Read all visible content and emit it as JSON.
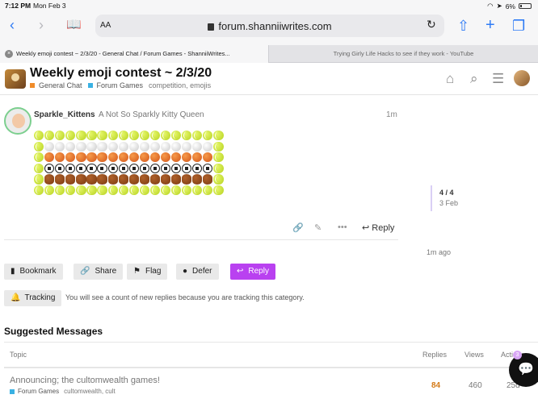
{
  "status": {
    "time": "7:12 PM",
    "date": "Mon Feb 3",
    "battery": "6%"
  },
  "browser": {
    "text_size_label": "AA",
    "url": "forum.shanniiwrites.com",
    "tabs": [
      {
        "title": "Weekly emoji contest ~ 2/3/20 - General Chat / Forum Games - ShanniiWrites...",
        "active": true
      },
      {
        "title": "Trying Girly Life Hacks to see if they work - YouTube",
        "active": false
      }
    ]
  },
  "forum": {
    "topic_title": "Weekly emoji contest ~ 2/3/20",
    "categories": [
      {
        "name": "General Chat",
        "color": "#f08c2a"
      },
      {
        "name": "Forum Games",
        "color": "#3ab1e3"
      }
    ],
    "tags": "competition, emojis"
  },
  "post": {
    "username": "Sparkle_Kittens",
    "user_title": "A Not So Sparkly Kitty Queen",
    "time": "1m",
    "emoji_rows": [
      [
        "tennis",
        "tennis",
        "tennis",
        "tennis",
        "tennis",
        "tennis",
        "tennis",
        "tennis",
        "tennis",
        "tennis",
        "tennis",
        "tennis",
        "tennis",
        "tennis",
        "tennis",
        "tennis",
        "tennis",
        "tennis"
      ],
      [
        "tennis",
        "volley",
        "volley",
        "volley",
        "volley",
        "volley",
        "volley",
        "volley",
        "volley",
        "volley",
        "volley",
        "volley",
        "volley",
        "volley",
        "volley",
        "volley",
        "volley",
        "tennis"
      ],
      [
        "tennis",
        "basket",
        "basket",
        "basket",
        "basket",
        "basket",
        "basket",
        "basket",
        "basket",
        "basket",
        "basket",
        "basket",
        "basket",
        "basket",
        "basket",
        "basket",
        "basket",
        "tennis"
      ],
      [
        "tennis",
        "soccer",
        "soccer",
        "soccer",
        "soccer",
        "soccer",
        "soccer",
        "soccer",
        "soccer",
        "soccer",
        "soccer",
        "soccer",
        "soccer",
        "soccer",
        "soccer",
        "soccer",
        "soccer",
        "tennis"
      ],
      [
        "tennis",
        "football",
        "football",
        "football",
        "football",
        "football",
        "football",
        "football",
        "football",
        "football",
        "football",
        "football",
        "football",
        "football",
        "football",
        "football",
        "football",
        "tennis"
      ],
      [
        "tennis",
        "tennis",
        "tennis",
        "tennis",
        "tennis",
        "tennis",
        "tennis",
        "tennis",
        "tennis",
        "tennis",
        "tennis",
        "tennis",
        "tennis",
        "tennis",
        "tennis",
        "tennis",
        "tennis",
        "tennis"
      ]
    ],
    "reply_label": "Reply"
  },
  "timeline": {
    "position": "4 / 4",
    "date": "3 Feb",
    "last_activity": "1m ago"
  },
  "footer": {
    "bookmark": "Bookmark",
    "share": "Share",
    "flag": "Flag",
    "defer": "Defer",
    "reply": "Reply",
    "tracking": "Tracking",
    "tracking_note": "You will see a count of new replies because you are tracking this category."
  },
  "suggested": {
    "title": "Suggested Messages",
    "headers": {
      "topic": "Topic",
      "replies": "Replies",
      "views": "Views",
      "activity": "Acti"
    },
    "rows": [
      {
        "title": "Announcing; the cultomwealth games!",
        "category": "Forum Games",
        "tags": "cultomwealth, cult",
        "replies": "84",
        "views": "460",
        "activity": "25d"
      }
    ]
  },
  "chat": {
    "badge": "3"
  },
  "colors": {
    "accent": "#b941f0",
    "link": "#2f7bf5",
    "hot": "#d47a17"
  }
}
